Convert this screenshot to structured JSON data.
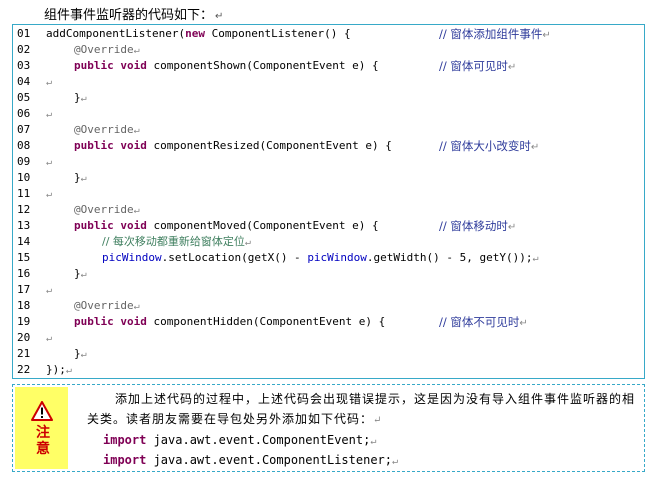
{
  "heading": "组件事件监听器的代码如下：",
  "para_mark": "↵",
  "code_lines": [
    {
      "num": "01",
      "indent": 0,
      "parts": [
        {
          "t": "addComponentListener(",
          "c": ""
        },
        {
          "t": "new",
          "c": "kw"
        },
        {
          "t": " ComponentListener() {",
          "c": ""
        }
      ],
      "comment": "// 窗体添加组件事件"
    },
    {
      "num": "02",
      "indent": 1,
      "parts": [
        {
          "t": "@Override",
          "c": "ann"
        }
      ],
      "comment": ""
    },
    {
      "num": "03",
      "indent": 1,
      "parts": [
        {
          "t": "public",
          "c": "kw"
        },
        {
          "t": " ",
          "c": ""
        },
        {
          "t": "void",
          "c": "kw"
        },
        {
          "t": " componentShown(ComponentEvent e) {",
          "c": ""
        }
      ],
      "comment": "// 窗体可见时"
    },
    {
      "num": "04",
      "indent": 0,
      "parts": [],
      "comment": ""
    },
    {
      "num": "05",
      "indent": 1,
      "parts": [
        {
          "t": "}",
          "c": ""
        }
      ],
      "comment": ""
    },
    {
      "num": "06",
      "indent": 0,
      "parts": [],
      "comment": ""
    },
    {
      "num": "07",
      "indent": 1,
      "parts": [
        {
          "t": "@Override",
          "c": "ann"
        }
      ],
      "comment": ""
    },
    {
      "num": "08",
      "indent": 1,
      "parts": [
        {
          "t": "public",
          "c": "kw"
        },
        {
          "t": " ",
          "c": ""
        },
        {
          "t": "void",
          "c": "kw"
        },
        {
          "t": " componentResized(ComponentEvent e) {",
          "c": ""
        }
      ],
      "comment": "// 窗体大小改变时"
    },
    {
      "num": "09",
      "indent": 0,
      "parts": [],
      "comment": ""
    },
    {
      "num": "10",
      "indent": 1,
      "parts": [
        {
          "t": "}",
          "c": ""
        }
      ],
      "comment": ""
    },
    {
      "num": "11",
      "indent": 0,
      "parts": [],
      "comment": ""
    },
    {
      "num": "12",
      "indent": 1,
      "parts": [
        {
          "t": "@Override",
          "c": "ann"
        }
      ],
      "comment": ""
    },
    {
      "num": "13",
      "indent": 1,
      "parts": [
        {
          "t": "public",
          "c": "kw"
        },
        {
          "t": " ",
          "c": ""
        },
        {
          "t": "void",
          "c": "kw"
        },
        {
          "t": " componentMoved(ComponentEvent e) {",
          "c": ""
        }
      ],
      "comment": "// 窗体移动时"
    },
    {
      "num": "14",
      "indent": 2,
      "parts": [
        {
          "t": "// 每次移动都重新给窗体定位",
          "c": "cmt"
        }
      ],
      "comment": ""
    },
    {
      "num": "15",
      "indent": 2,
      "parts": [
        {
          "t": "picWindow",
          "c": "var"
        },
        {
          "t": ".setLocation(getX() - ",
          "c": ""
        },
        {
          "t": "picWindow",
          "c": "var"
        },
        {
          "t": ".getWidth() - 5, getY());",
          "c": ""
        }
      ],
      "comment": ""
    },
    {
      "num": "16",
      "indent": 1,
      "parts": [
        {
          "t": "}",
          "c": ""
        }
      ],
      "comment": ""
    },
    {
      "num": "17",
      "indent": 0,
      "parts": [],
      "comment": ""
    },
    {
      "num": "18",
      "indent": 1,
      "parts": [
        {
          "t": "@Override",
          "c": "ann"
        }
      ],
      "comment": ""
    },
    {
      "num": "19",
      "indent": 1,
      "parts": [
        {
          "t": "public",
          "c": "kw"
        },
        {
          "t": " ",
          "c": ""
        },
        {
          "t": "void",
          "c": "kw"
        },
        {
          "t": " componentHidden(ComponentEvent e) {",
          "c": ""
        }
      ],
      "comment": "// 窗体不可见时"
    },
    {
      "num": "20",
      "indent": 0,
      "parts": [],
      "comment": ""
    },
    {
      "num": "21",
      "indent": 1,
      "parts": [
        {
          "t": "}",
          "c": ""
        }
      ],
      "comment": ""
    },
    {
      "num": "22",
      "indent": 0,
      "parts": [
        {
          "t": "});",
          "c": ""
        }
      ],
      "comment": ""
    }
  ],
  "note": {
    "label": "注意",
    "icon": "warning-icon",
    "accent": "#cc0000",
    "background": "#ffff66",
    "text": "添加上述代码的过程中，上述代码会出现错误提示，这是因为没有导入组件事件监听器的相关类。读者朋友需要在导包处另外添加如下代码：",
    "imports": [
      {
        "kw": "import",
        "rest": " java.awt.event.ComponentEvent;"
      },
      {
        "kw": "import",
        "rest": " java.awt.event.ComponentListener;"
      }
    ]
  }
}
